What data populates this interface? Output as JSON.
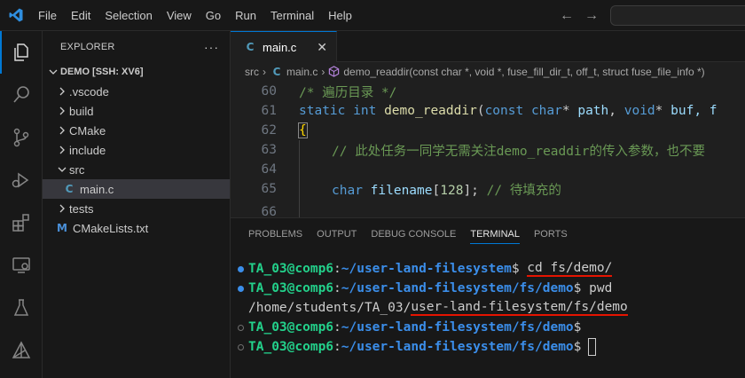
{
  "menu": [
    "File",
    "Edit",
    "Selection",
    "View",
    "Go",
    "Run",
    "Terminal",
    "Help"
  ],
  "nav": {
    "back": "←",
    "forward": "→"
  },
  "activity": [
    "explorer-icon",
    "search-icon",
    "source-control-icon",
    "run-debug-icon",
    "extensions-icon",
    "remote-explorer-icon",
    "testing-icon",
    "cmake-icon"
  ],
  "sidebar": {
    "title": "EXPLORER",
    "more": "···",
    "workspace": "DEMO [SSH: XV6]",
    "tree": [
      {
        "label": ".vscode",
        "type": "folder",
        "open": false
      },
      {
        "label": "build",
        "type": "folder",
        "open": false
      },
      {
        "label": "CMake",
        "type": "folder",
        "open": false
      },
      {
        "label": "include",
        "type": "folder",
        "open": false
      },
      {
        "label": "src",
        "type": "folder",
        "open": true
      },
      {
        "label": "main.c",
        "type": "c-file",
        "selected": true
      },
      {
        "label": "tests",
        "type": "folder",
        "open": false
      },
      {
        "label": "CMakeLists.txt",
        "type": "cmake-file"
      }
    ]
  },
  "editor": {
    "tab_label": "main.c",
    "tab_icon": "C",
    "tab_close": "✕",
    "breadcrumb": {
      "root": "src",
      "file": "main.c",
      "symbol": "demo_readdir(const char *, void *, fuse_fill_dir_t, off_t, struct fuse_file_info *)"
    },
    "lines": {
      "n60": "60",
      "n61": "61",
      "n62": "62",
      "n63": "63",
      "n64": "64",
      "n65": "65",
      "n66": "66",
      "l60": "/* 遍历目录 */",
      "l61_kw1": "static",
      "l61_kw2": "int",
      "l61_fn": "demo_readdir",
      "l61_p1": "(",
      "l61_kw3": "const",
      "l61_kw4": "char",
      "l61_p2": "* ",
      "l61_v1": "path",
      "l61_p3": ", ",
      "l61_kw5": "void",
      "l61_p4": "* ",
      "l61_v2": "buf",
      "l61_p5": ", f",
      "l62": "{",
      "l63": "// 此处任务一同学无需关注demo_readdir的传入参数，也不要",
      "l65_kw": "char",
      "l65_v": "filename",
      "l65_p1": "[",
      "l65_num": "128",
      "l65_p2": "]; ",
      "l65_c": "// 待填充的"
    }
  },
  "panel": {
    "tabs": [
      "PROBLEMS",
      "OUTPUT",
      "DEBUG CONSOLE",
      "TERMINAL",
      "PORTS"
    ],
    "active_tab": "TERMINAL"
  },
  "terminal": {
    "prompt_user": "TA_03@comp6",
    "colon": ":",
    "path1": "~/user-land-filesystem",
    "path2": "~/user-land-filesystem/fs/demo",
    "dollar": "$ ",
    "cmd1": "cd fs/demo/",
    "cmd2": "pwd",
    "output_prefix": "/home/students/TA_03/",
    "output_rest": "user-land-filesystem/fs/demo",
    "dollar_end": "$"
  },
  "colors": {
    "accent": "#0078d4",
    "terminal_user": "#23d18b",
    "terminal_path": "#3b8eea",
    "annotation_underline": "#e51400"
  }
}
